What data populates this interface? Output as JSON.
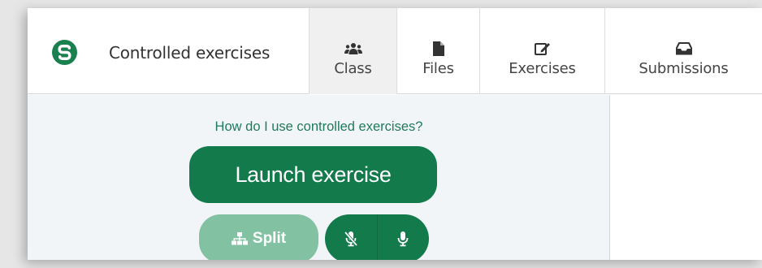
{
  "app": {
    "title": "Controlled exercises",
    "logo_icon": "s-logo-icon",
    "brand_color": "#1a8050"
  },
  "tabs": [
    {
      "label": "Class",
      "icon": "users-icon",
      "active": true
    },
    {
      "label": "Files",
      "icon": "file-icon",
      "active": false
    },
    {
      "label": "Exercises",
      "icon": "edit-icon",
      "active": false
    },
    {
      "label": "Submissions",
      "icon": "inbox-icon",
      "active": false
    }
  ],
  "main": {
    "help_link": "How do I use controlled exercises?",
    "launch_label": "Launch exercise",
    "split_label": "Split",
    "split_icon": "sitemap-icon",
    "mic_off_icon": "microphone-slash-icon",
    "mic_on_icon": "microphone-icon"
  },
  "colors": {
    "primary": "#137a4c",
    "primary_disabled": "#82c2a3",
    "link": "#1f7a5a",
    "panel_bg": "#f2f5f8"
  }
}
